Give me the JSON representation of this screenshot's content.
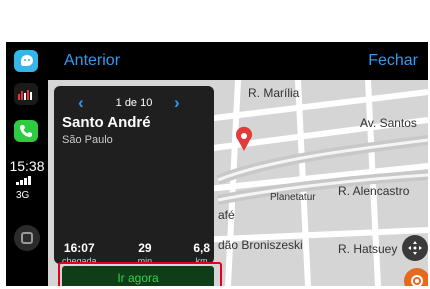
{
  "topbar": {
    "back_label": "Anterior",
    "close_label": "Fechar"
  },
  "status": {
    "time": "15:38",
    "network": "3G"
  },
  "card": {
    "counter": "1 de 10",
    "destination": "Santo André",
    "city": "São Paulo",
    "stats": [
      {
        "value": "16:07",
        "unit": "chegada"
      },
      {
        "value": "29",
        "unit": "min"
      },
      {
        "value": "6,8",
        "unit": "km"
      }
    ],
    "go_label": "Ir agora"
  },
  "map": {
    "streets": [
      "R. Marília",
      "Av. Santos",
      "R. Alencastro",
      "Planetatur",
      "afé",
      "dão Broniszeski",
      "R. Hatsuey"
    ]
  },
  "colors": {
    "accent": "#2f9bf2",
    "go_text": "#35d14f",
    "highlight": "#e3001b"
  }
}
